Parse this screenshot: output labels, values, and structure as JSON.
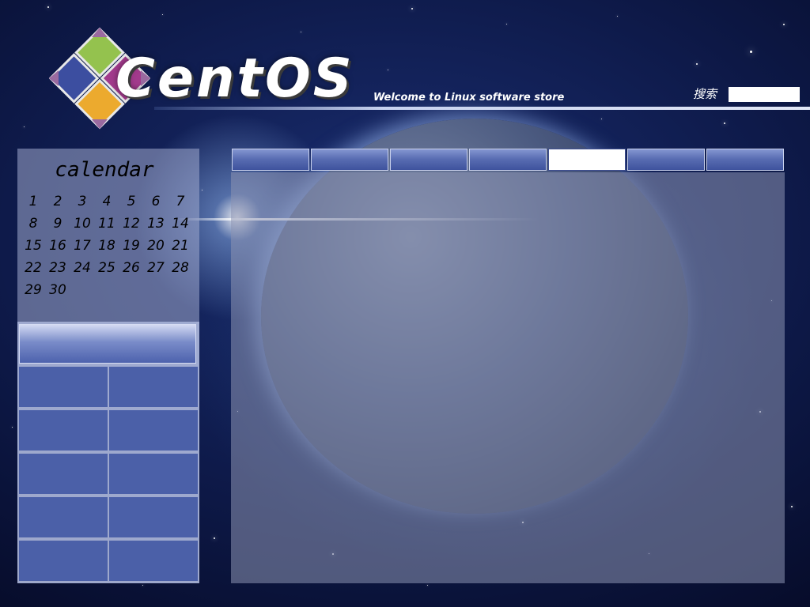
{
  "header": {
    "logo_text": "CentOS",
    "tagline": "Welcome to Linux software store",
    "search_label": "搜索",
    "search_value": ""
  },
  "calendar": {
    "title": "calendar",
    "days": [
      "1",
      "2",
      "3",
      "4",
      "5",
      "6",
      "7",
      "8",
      "9",
      "10",
      "11",
      "12",
      "13",
      "14",
      "15",
      "16",
      "17",
      "18",
      "19",
      "20",
      "21",
      "22",
      "23",
      "24",
      "25",
      "26",
      "27",
      "28",
      "29",
      "30"
    ]
  },
  "tabs": [
    {
      "label": "",
      "active": false
    },
    {
      "label": "",
      "active": false
    },
    {
      "label": "",
      "active": false
    },
    {
      "label": "",
      "active": false
    },
    {
      "label": "",
      "active": true
    },
    {
      "label": "",
      "active": false
    },
    {
      "label": "",
      "active": false
    }
  ],
  "left_grid": {
    "header": "",
    "cells": [
      "",
      "",
      "",
      "",
      "",
      "",
      "",
      "",
      "",
      ""
    ]
  },
  "colors": {
    "background": "#0e1a4a",
    "tab_fill": "#5a6eb3",
    "cell_fill": "#4b60a8",
    "panel_overlay": "#8c94b2"
  }
}
